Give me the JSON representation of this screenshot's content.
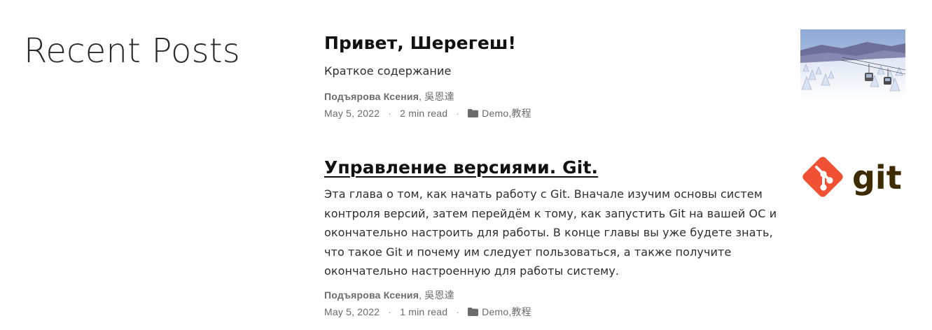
{
  "section": {
    "title": "Recent Posts"
  },
  "posts": [
    {
      "title": "Привет, Шерегеш!",
      "summary": "Краткое содержание",
      "author_primary": "Подъярова Ксения",
      "author_separator": ", ",
      "author_secondary": "吳恩達",
      "date": "May 5, 2022",
      "read_time": "2 min read",
      "categories": [
        "Demo",
        "教程"
      ],
      "category_separator": ", ",
      "dot": "·",
      "thumbnail": "mountain-cable-car-photo"
    },
    {
      "title": "Управление версиями. Git.",
      "summary": "Эта глава о том, как начать работу с Git. Вначале изучим основы систем контроля версий, затем перейдём к тому, как запустить Git на вашей ОС и окончательно настроить для работы. В конце главы вы уже будете знать, что такое Git и почему им следует пользоваться, а также получите окончательно настроенную для работы систему.",
      "author_primary": "Подъярова Ксения",
      "author_separator": ", ",
      "author_secondary": "吳恩達",
      "date": "May 5, 2022",
      "read_time": "1 min read",
      "categories": [
        "Demo",
        "教程"
      ],
      "category_separator": ", ",
      "dot": "·",
      "thumbnail": "git-logo",
      "thumbnail_text": "git"
    }
  ],
  "colors": {
    "git_orange": "#f05033",
    "git_text": "#3e2c00"
  }
}
